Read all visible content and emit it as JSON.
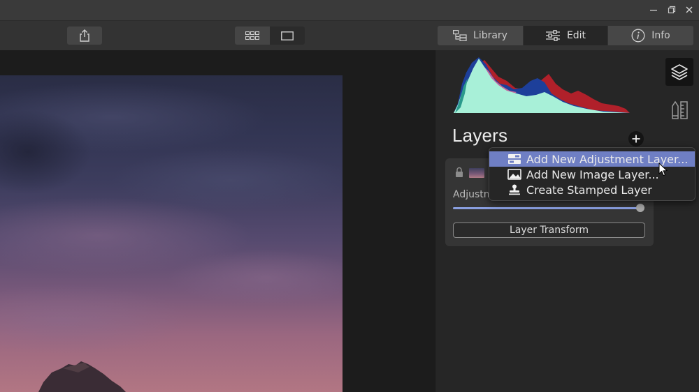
{
  "window": {
    "minimize_icon": "minimize-icon",
    "restore_icon": "restore-icon",
    "close_icon": "close-icon"
  },
  "toolbar": {
    "share_icon": "share-icon",
    "view_grid_icon": "grid-view-icon",
    "view_single_icon": "single-view-icon",
    "tabs": [
      {
        "id": "library",
        "label": "Library",
        "icon": "library-icon"
      },
      {
        "id": "edit",
        "label": "Edit",
        "icon": "sliders-icon",
        "active": true
      },
      {
        "id": "info",
        "label": "Info",
        "icon": "info-icon"
      }
    ]
  },
  "panel": {
    "histogram": {
      "colors": [
        "#a8f0d8",
        "#1d3f9a",
        "#b0202a",
        "#d66a9c",
        "#2a9a8c"
      ]
    },
    "layers_title": "Layers",
    "add_layer_symbol": "+",
    "layer": {
      "name_truncated": "Adjustm",
      "opacity": 1.0,
      "transform_label": "Layer Transform"
    }
  },
  "menu": {
    "items": [
      {
        "label": "Add New Adjustment Layer...",
        "icon": "adjustment-layer-icon",
        "hovered": true
      },
      {
        "label": "Add New Image Layer...",
        "icon": "image-layer-icon"
      },
      {
        "label": "Create Stamped Layer",
        "icon": "stamp-icon"
      }
    ]
  },
  "colors": {
    "accent": "#6f7fc4",
    "slider_track": "#8a9fe0"
  }
}
